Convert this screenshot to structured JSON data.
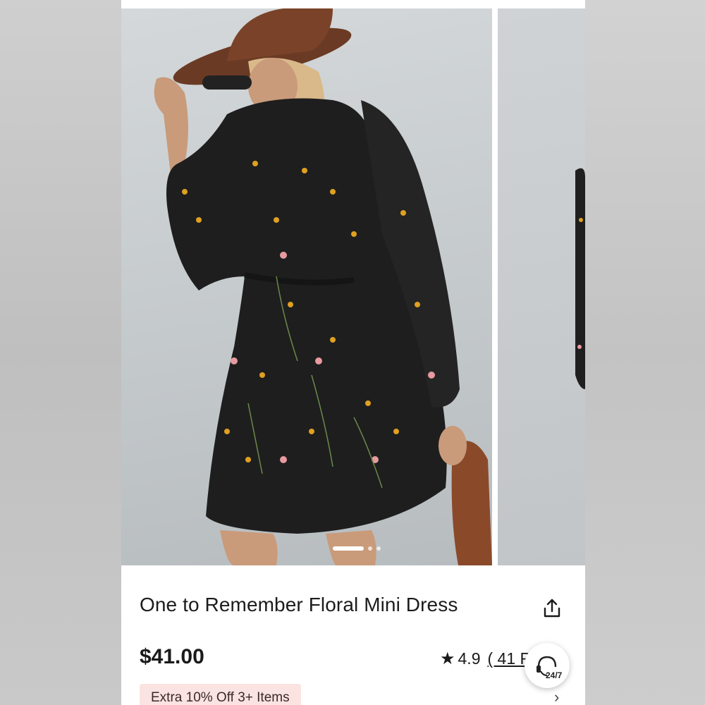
{
  "product": {
    "title": "One to Remember Floral Mini Dress",
    "price": "$41.00",
    "rating": "4.9",
    "reviews_label": "( 41 Re"
  },
  "promo": {
    "label": "Extra 10% Off 3+ Items"
  },
  "support": {
    "label": "24/7"
  },
  "icons": {
    "share": "share-icon",
    "star": "star-icon",
    "support": "headset-icon",
    "chevron": "chevron-right-icon"
  },
  "colors": {
    "promo_bg": "#fbe3e1",
    "text": "#1c1c1c"
  }
}
